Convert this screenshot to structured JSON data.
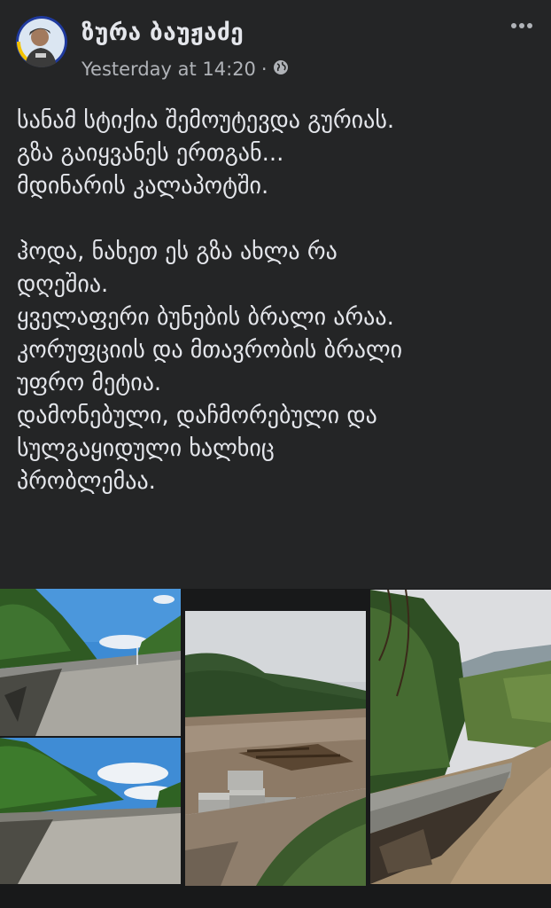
{
  "author": {
    "name": "ზურა ბაუჟაძე"
  },
  "post": {
    "timestamp": "Yesterday at 14:20",
    "separator": "·",
    "audience_icon": "globe-icon",
    "more_icon": "more-options-icon",
    "lines": [
      "სანამ სტიქია შემოუტევდა გურიას.",
      "გზა გაიყვანეს ერთგან...",
      "მდინარის კალაპოტში.",
      "",
      "ჰოდა, ნახეთ ეს გზა ახლა რა",
      "დღეშია.",
      "ყველაფერი ბუნების ბრალი არაა.",
      "კორუფციის და მთავრობის ბრალი",
      "უფრო მეტია.",
      "დამონებული, დაჩმორებული და",
      "სულგაყიდული ხალხიც",
      "პრობლემაა."
    ]
  },
  "photos": [
    {
      "subject": "gravel-road-field-photo"
    },
    {
      "subject": "gravel-road-trees-photo"
    },
    {
      "subject": "flooded-road-concrete-blocks-photo"
    },
    {
      "subject": "washed-out-road-river-photo"
    }
  ],
  "colors": {
    "background": "#242526",
    "text": "#e4e6eb",
    "secondary_text": "#b0b3b8"
  }
}
